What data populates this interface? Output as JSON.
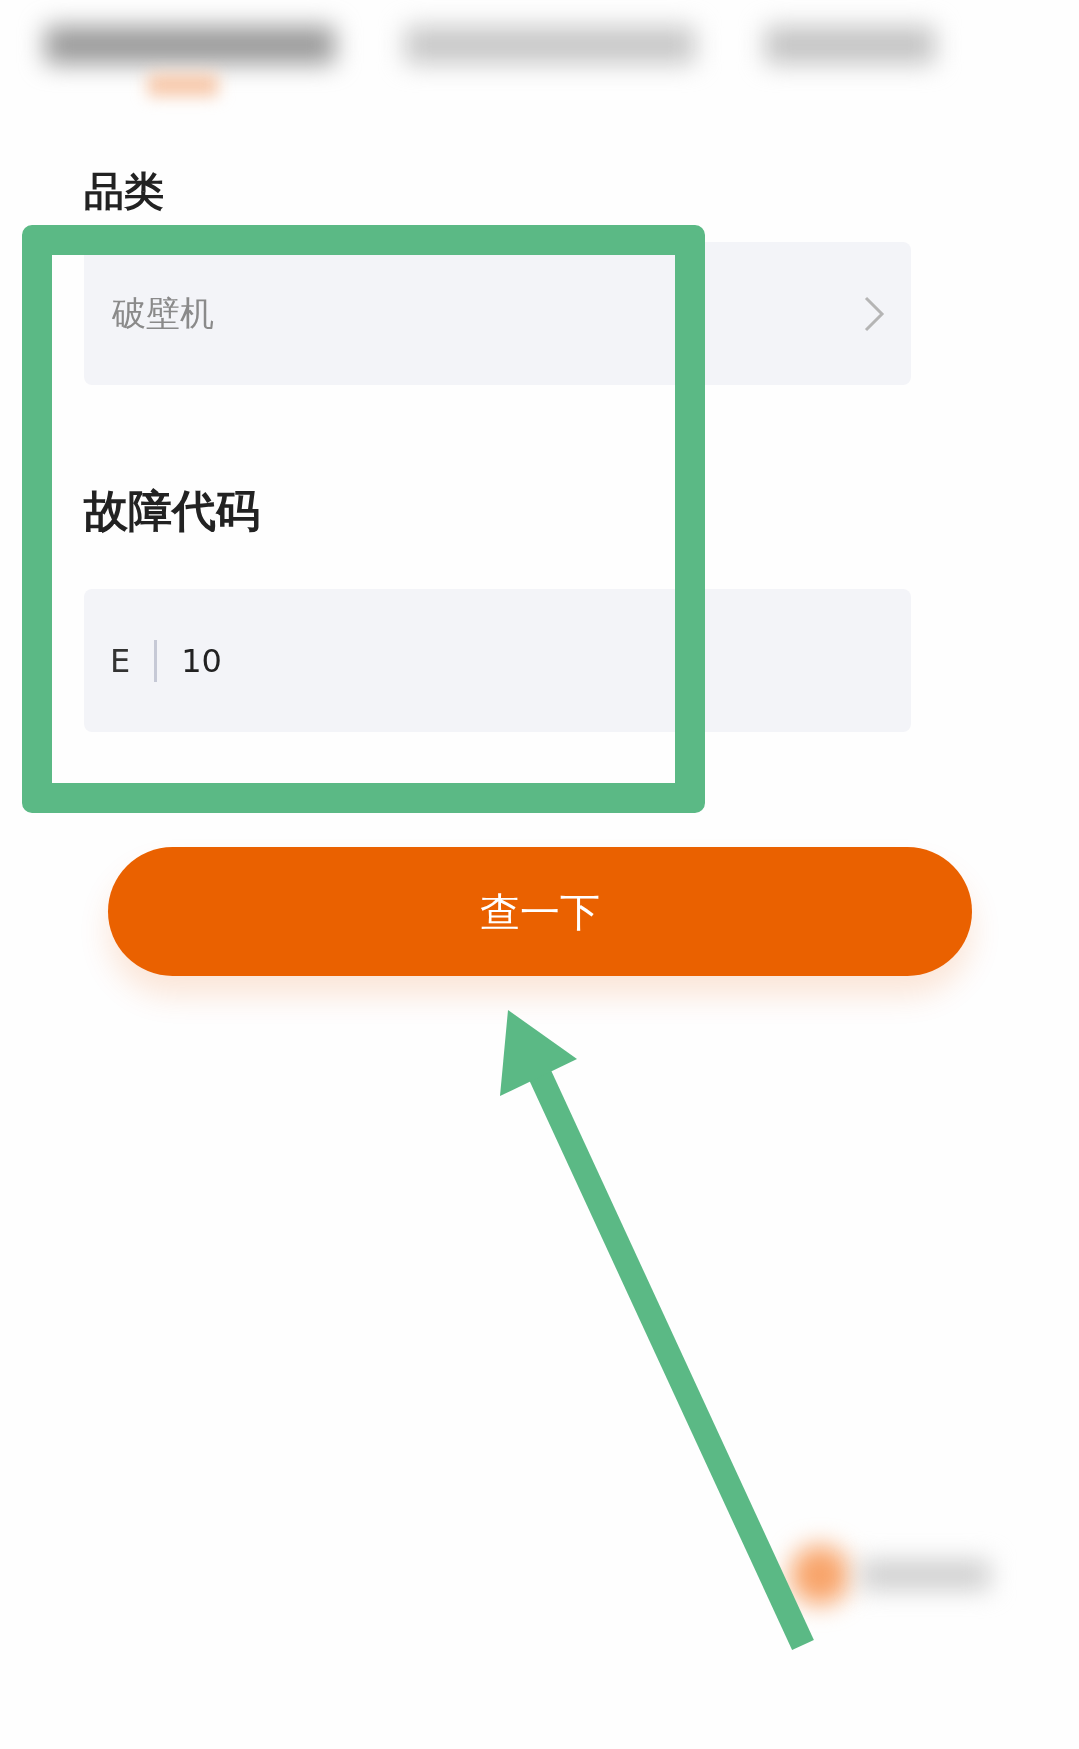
{
  "category": {
    "label": "品类",
    "value": "破壁机"
  },
  "fault_code": {
    "label": "故障代码",
    "prefix": "E",
    "value": "10"
  },
  "submit_button": {
    "label": "查一下"
  }
}
